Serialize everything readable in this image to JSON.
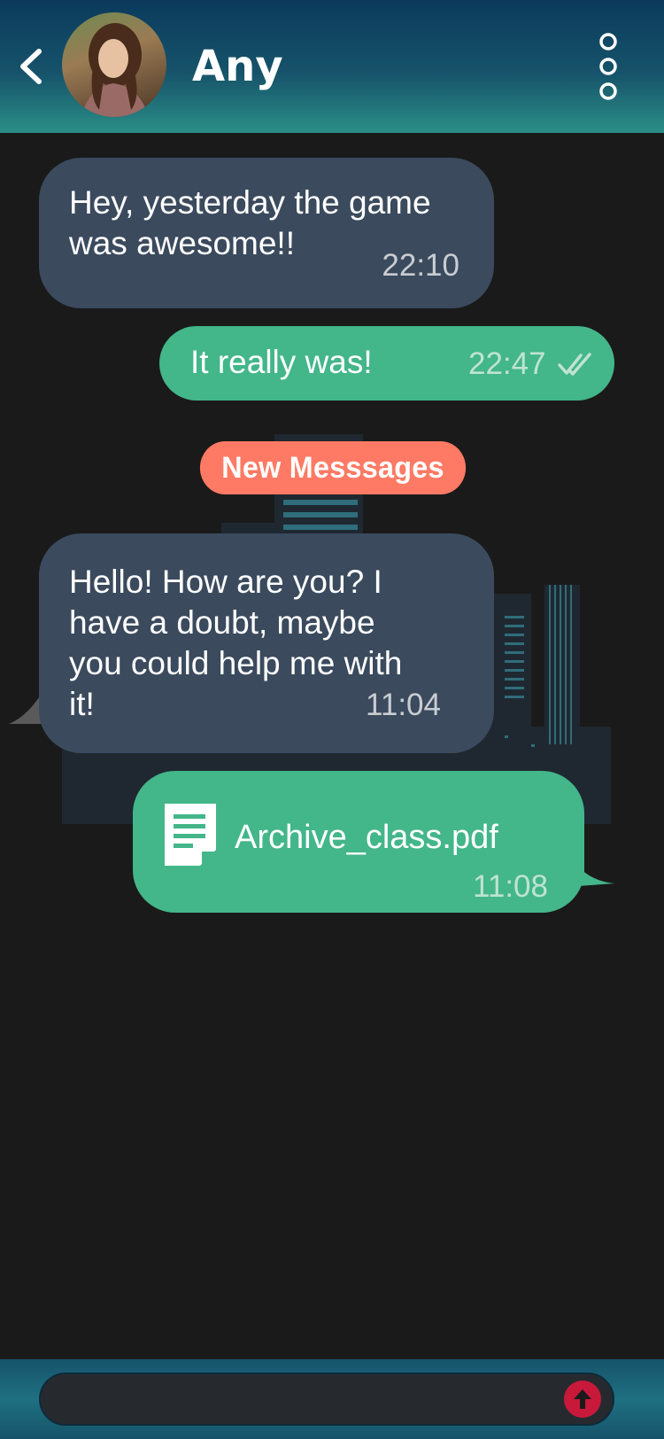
{
  "header": {
    "contact_name": "Any"
  },
  "messages": [
    {
      "direction": "incoming",
      "text": "Hey, yesterday the game was awesome!!",
      "time": "22:10"
    },
    {
      "direction": "outgoing",
      "text": "It really was!",
      "time": "22:47",
      "status_icon": "double-check-icon"
    },
    {
      "direction": "incoming",
      "text": "Hello! How are you? I have a doubt, maybe you could help me with it!",
      "time": "11:04"
    },
    {
      "direction": "outgoing",
      "type": "file",
      "text": "Archive_class.pdf",
      "time": "11:08",
      "icon": "file-icon"
    }
  ],
  "divider": {
    "label": "New Messsages"
  },
  "composer": {
    "placeholder": "",
    "send_icon": "arrow-up-icon"
  },
  "colors": {
    "background": "#1a1a1a",
    "incoming_bubble": "#3b4a5d",
    "outgoing_bubble": "#43b68a",
    "badge": "#ff7a64",
    "send_button": "#c8193a",
    "header_top": "#0b3a5c",
    "header_bottom": "#2a8e86"
  }
}
